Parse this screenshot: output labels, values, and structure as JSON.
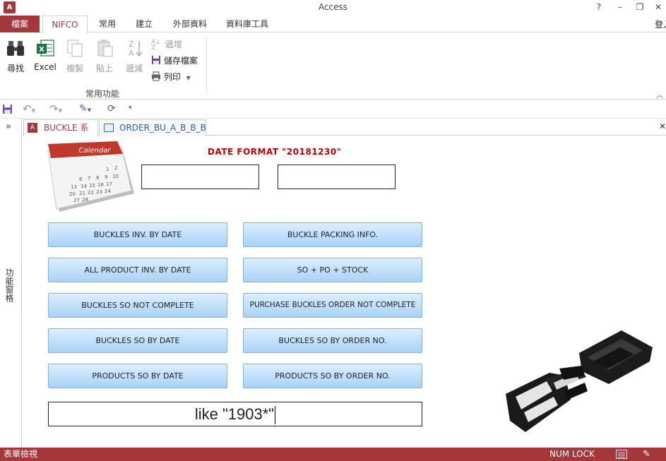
{
  "window": {
    "title": "Access",
    "help": "?",
    "minimize": "–",
    "restore": "❐",
    "close": "✕",
    "login": "登入"
  },
  "ribbon_tabs": {
    "file": "檔案",
    "tabs": [
      "NIFCO",
      "常用",
      "建立",
      "外部資料",
      "資料庫工具"
    ]
  },
  "ribbon": {
    "find": "尋找",
    "excel": "Excel",
    "copy": "複製",
    "paste": "貼上",
    "sort_desc": "遞減",
    "sort_asc": "遞增",
    "save": "儲存檔案",
    "print": "列印",
    "group": "常用功能"
  },
  "nav_pane": {
    "toggle": "»",
    "label": "功能窗格"
  },
  "doc_tabs": [
    "BUCKLE 系統",
    "ORDER_BU_A_B_B_B"
  ],
  "form": {
    "calendar_label": "Calendar",
    "date_format": "DATE FORMAT \"20181230\"",
    "start_date": "",
    "end_date": "",
    "left_buttons": [
      "BUCKLES INV. BY DATE",
      "ALL PRODUCT INV. BY DATE",
      "BUCKLES SO NOT COMPLETE",
      "BUCKLES SO BY DATE",
      "PRODUCTS SO BY DATE"
    ],
    "right_buttons": [
      "BUCKLE PACKING INFO.",
      "SO + PO + STOCK",
      "PURCHASE BUCKLES ORDER NOT COMPLETE",
      "BUCKLES SO BY ORDER NO.",
      "PRODUCTS SO BY ORDER NO."
    ],
    "search_value": "like \"1903*\""
  },
  "status": {
    "view": "表單檢視",
    "numlock": "NUM LOCK"
  },
  "colors": {
    "accent": "#a4373a",
    "date_format_red": "#c00000",
    "button_top": "#dcefff",
    "button_bottom": "#a9d2f6"
  }
}
